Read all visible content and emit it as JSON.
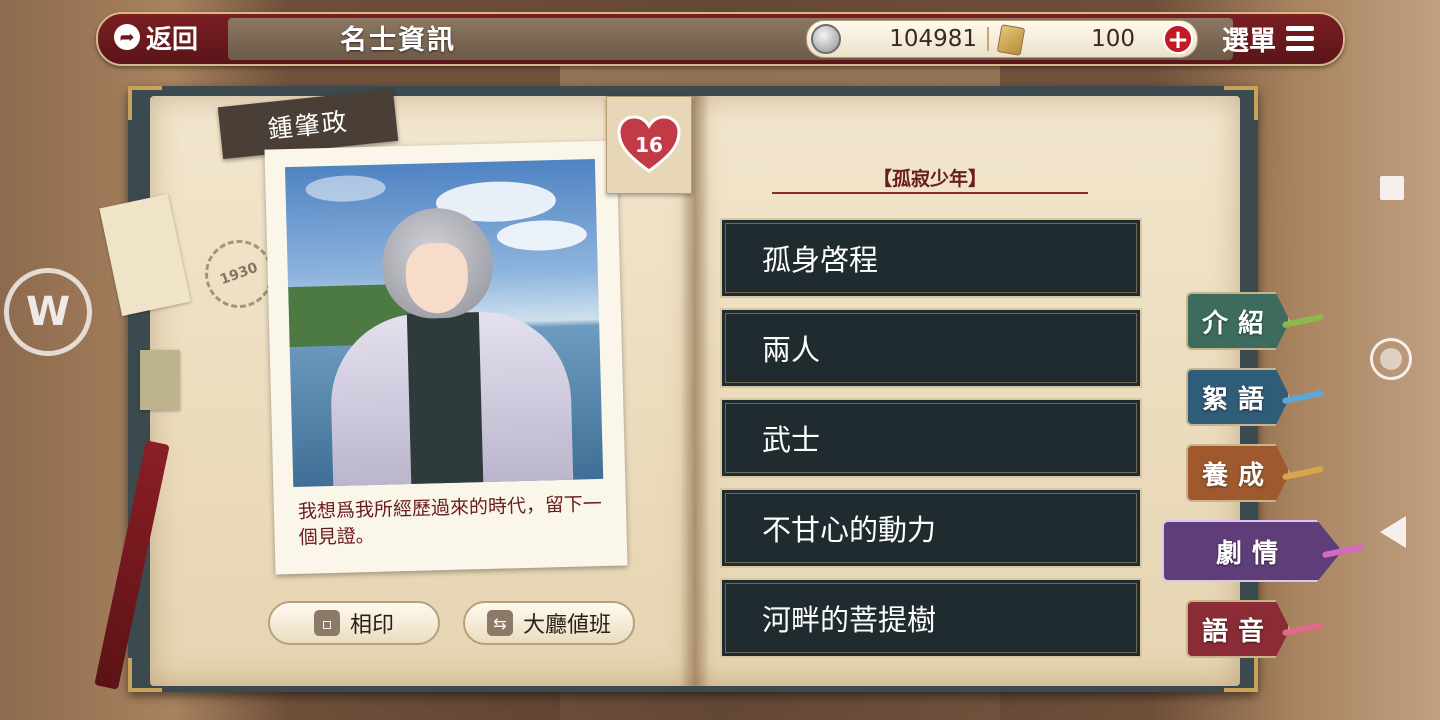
{
  "header": {
    "back_label": "返回",
    "title": "名士資訊",
    "coins": "104981",
    "tickets": "100",
    "menu_label": "選單"
  },
  "character": {
    "name": "鍾肇政",
    "quote": "我想爲我所經歷過來的時代，留下一個見證。",
    "affection": "16",
    "stamp_text": "1930"
  },
  "buttons": {
    "stamp_label": "相印",
    "lobby_label": "大廳値班"
  },
  "story": {
    "title": "【孤寂少年】",
    "chapters": [
      "孤身啓程",
      "兩人",
      "武士",
      "不甘心的動力",
      "河畔的菩提樹"
    ]
  },
  "tabs": [
    {
      "label": "介紹",
      "color": "#3d6b5e"
    },
    {
      "label": "絮語",
      "color": "#2f5c78"
    },
    {
      "label": "養成",
      "color": "#a0582e"
    },
    {
      "label": "劇情",
      "color": "#5f3d78"
    },
    {
      "label": "語音",
      "color": "#8a2b35"
    }
  ],
  "icons": {
    "back": "back-arrow-icon",
    "coin": "silver-coin-icon",
    "ticket": "gold-ticket-icon",
    "plus": "plus-icon",
    "menu": "menu-list-icon",
    "heart": "heart-icon",
    "stamp_btn": "photo-card-icon",
    "lobby_btn": "swap-arrows-icon"
  }
}
